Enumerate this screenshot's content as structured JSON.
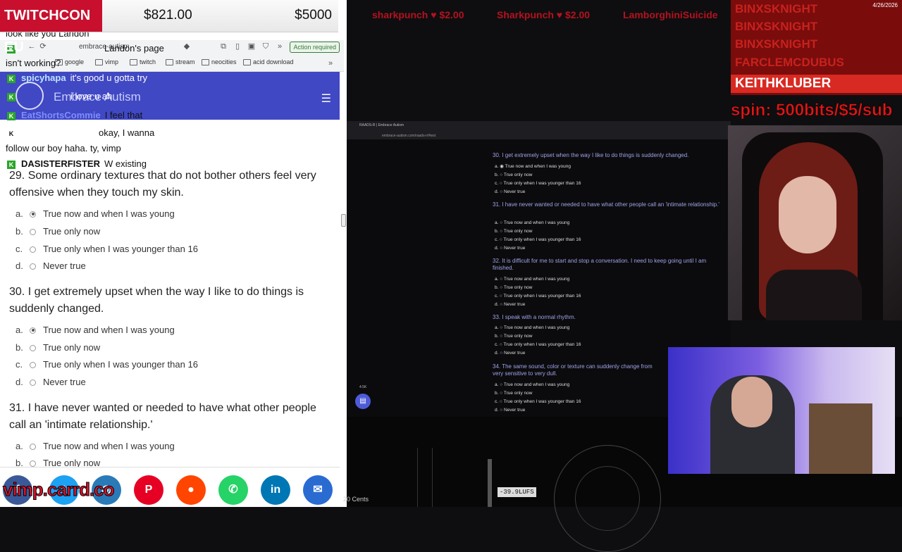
{
  "donation_bar": {
    "brand": "TWITCHCON EU",
    "amount_raised": "$821.00",
    "goal": "$5000"
  },
  "ticker": {
    "items": [
      "sharkpunch ♥ $2.00",
      "Sharkpunch ♥ $2.00",
      "LamborghiniSuicide"
    ]
  },
  "browser": {
    "tab_label": "embrace-autism",
    "action_required": "Action required",
    "bookmarks": [
      "google",
      "vimp",
      "twitch",
      "stream",
      "neocities",
      "acid download"
    ]
  },
  "site": {
    "name": "Embrace Autism"
  },
  "chat": [
    {
      "user": "",
      "message": "look like you Landon"
    },
    {
      "user": "",
      "message": "Landon's page"
    },
    {
      "user": "",
      "message": "isn't working?"
    },
    {
      "user": "spicyhapa",
      "message": "it's good u gotta try"
    },
    {
      "user": "",
      "message": "i love u ah"
    },
    {
      "user": "EatShortsCommie",
      "message": "I feel that"
    },
    {
      "user": "",
      "message": "okay, I wanna"
    },
    {
      "user": "",
      "message": "follow our boy haha. ty, vimp"
    },
    {
      "user": "DASISTERFISTER",
      "message": "W existing"
    }
  ],
  "questions": [
    {
      "text": "29. Some ordinary textures that do not bother others feel very offensive when they touch my skin.",
      "options": [
        {
          "letter": "a.",
          "label": "True now and when I was young",
          "selected": true
        },
        {
          "letter": "b.",
          "label": "True only now",
          "selected": false
        },
        {
          "letter": "c.",
          "label": "True only when I was younger than 16",
          "selected": false
        },
        {
          "letter": "d.",
          "label": "Never true",
          "selected": false
        }
      ]
    },
    {
      "text": "30. I get extremely upset when the way I like to do things is suddenly changed.",
      "options": [
        {
          "letter": "a.",
          "label": "True now and when I was young",
          "selected": true
        },
        {
          "letter": "b.",
          "label": "True only now",
          "selected": false
        },
        {
          "letter": "c.",
          "label": "True only when I was younger than 16",
          "selected": false
        },
        {
          "letter": "d.",
          "label": "Never true",
          "selected": false
        }
      ]
    },
    {
      "text": "31. I have never wanted or needed to have what other people call an 'intimate relationship.'",
      "options": [
        {
          "letter": "a.",
          "label": "True now and when I was young",
          "selected": false
        },
        {
          "letter": "b.",
          "label": "True only now",
          "selected": false
        }
      ]
    }
  ],
  "shared_screen": {
    "tab_title": "RAADS-R | Embrace Autism",
    "url": "embrace-autism.com/raads-r/#test",
    "views": "4.5K",
    "questions": [
      {
        "text": "30. I get extremely upset when the way I like to do things is suddenly changed."
      },
      {
        "text": "31. I have never wanted or needed to have what other people call an 'intimate relationship.'"
      },
      {
        "text": "32. It is difficult for me to start and stop a conversation. I need to keep going until I am finished."
      },
      {
        "text": "33. I speak with a normal rhythm."
      },
      {
        "text": "34. The same sound, color or texture can suddenly change from very sensitive to very dull."
      }
    ],
    "options": [
      "True now and when I was young",
      "True only now",
      "True only when I was younger than 16",
      "Never true"
    ],
    "option_letters": [
      "a.",
      "b.",
      "c.",
      "d."
    ]
  },
  "audio": {
    "lufs": "-39.9LUFS",
    "cents": "20 Cents"
  },
  "subs": {
    "names": [
      "BINXSKNIGHT",
      "BINXSKNIGHT",
      "BINXSKNIGHT",
      "FARCLEMCDUBUS"
    ],
    "latest": "KEITHKLUBER",
    "date": "4/26/2026"
  },
  "spin_text": "spin: 500bits/$5/sub",
  "social": {
    "site": "vimp.carrd.co",
    "icons": [
      "facebook-icon",
      "twitter-icon",
      "instagram-icon",
      "pinterest-icon",
      "reddit-icon",
      "whatsapp-icon",
      "linkedin-icon",
      "mail-icon"
    ]
  },
  "colors": {
    "brand_red": "#c8102e",
    "site_header": "#4048c4",
    "chat_badge": "#2aa52a"
  }
}
